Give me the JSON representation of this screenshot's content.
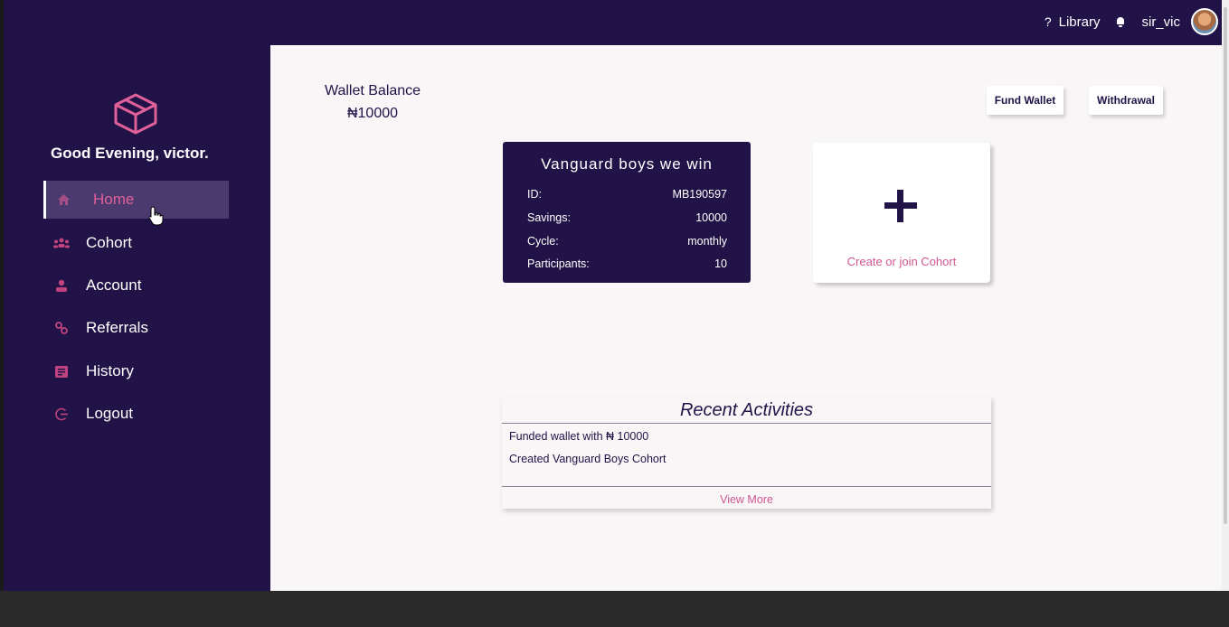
{
  "topbar": {
    "help_icon": "?",
    "library_label": "Library",
    "bell_icon": "bell-icon",
    "username": "sir_vic",
    "avatar_icon": "avatar"
  },
  "sidebar": {
    "logo_icon": "cube-icon",
    "greeting": "Good Evening, victor.",
    "items": [
      {
        "label": "Home",
        "icon": "home-icon",
        "active": true
      },
      {
        "label": "Cohort",
        "icon": "group-icon",
        "active": false
      },
      {
        "label": "Account",
        "icon": "user-icon",
        "active": false
      },
      {
        "label": "Referrals",
        "icon": "referral-icon",
        "active": false
      },
      {
        "label": "History",
        "icon": "history-icon",
        "active": false
      },
      {
        "label": "Logout",
        "icon": "logout-icon",
        "active": false
      }
    ]
  },
  "wallet": {
    "title": "Wallet Balance",
    "amount": "₦10000",
    "fund_label": "Fund Wallet",
    "withdraw_label": "Withdrawal"
  },
  "cohort_card": {
    "title": "Vanguard boys we win",
    "rows": [
      {
        "key": "ID:",
        "value": "MB190597"
      },
      {
        "key": "Savings:",
        "value": "10000"
      },
      {
        "key": "Cycle:",
        "value": "monthly"
      },
      {
        "key": "Participants:",
        "value": "10"
      }
    ]
  },
  "create_card": {
    "label": "Create or join Cohort"
  },
  "activities": {
    "title": "Recent Activities",
    "items": [
      "Funded wallet with ₦ 10000",
      "Created Vanguard Boys Cohort"
    ],
    "view_more": "View More"
  },
  "colors": {
    "brand_dark": "#211347",
    "accent_pink": "#d05592",
    "background": "#f9f6f8"
  }
}
